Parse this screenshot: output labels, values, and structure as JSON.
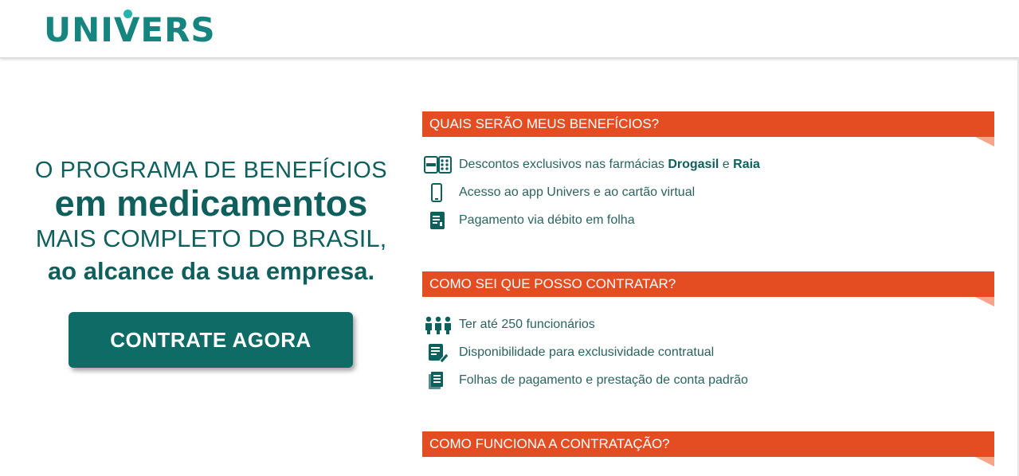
{
  "header": {
    "logo_text": "UNIVERS"
  },
  "hero": {
    "line1": "O PROGRAMA DE BENEFÍCIOS",
    "line2": "em medicamentos",
    "line3": "MAIS COMPLETO DO BRASIL,",
    "line4": "ao alcance da sua empresa."
  },
  "cta": {
    "label": "CONTRATE AGORA"
  },
  "colors": {
    "brand_teal": "#0f6b66",
    "accent_orange": "#e44d22",
    "text_teal": "#2a6360"
  },
  "sections": [
    {
      "title": "QUAIS SERÃO MEUS BENEFÍCIOS?",
      "items": [
        {
          "icon": "pharmacy-pills-icon",
          "pre": "Descontos exclusivos nas farmácias ",
          "b1": "Drogasil",
          "mid": " e ",
          "b2": "Raia"
        },
        {
          "icon": "smartphone-icon",
          "text": "Acesso ao app Univers e ao cartão virtual"
        },
        {
          "icon": "payslip-icon",
          "text": "Pagamento via débito em folha"
        }
      ]
    },
    {
      "title": "COMO SEI QUE POSSO CONTRATAR?",
      "items": [
        {
          "icon": "people-icon",
          "text": "Ter até 250 funcionários"
        },
        {
          "icon": "contract-sign-icon",
          "text": "Disponibilidade para exclusividade contratual"
        },
        {
          "icon": "documents-stack-icon",
          "text": "Folhas de pagamento e prestação de conta padrão"
        }
      ]
    },
    {
      "title": "COMO FUNCIONA A CONTRATAÇÃO?"
    }
  ]
}
